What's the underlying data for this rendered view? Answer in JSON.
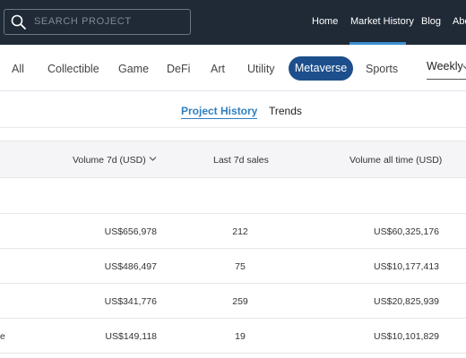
{
  "topnav": {
    "search_placeholder": "SEARCH PROJECT",
    "links": [
      "Home",
      "Market History",
      "Blog",
      "Abo"
    ]
  },
  "categories": {
    "items": [
      "All",
      "Collectible",
      "Game",
      "DeFi",
      "Art",
      "Utility",
      "Metaverse",
      "Sports"
    ],
    "active": "Metaverse",
    "period": "Weekly"
  },
  "subtabs": {
    "project_history": "Project History",
    "trends": "Trends"
  },
  "table": {
    "headers": {
      "volume_7d": "Volume 7d (USD)",
      "last_7d_sales": "Last 7d sales",
      "volume_all_time": "Volume all time (USD)"
    },
    "rows": [
      {
        "name": "",
        "volume_7d": "US$656,978",
        "sales": "212",
        "volume_all": "US$60,325,176"
      },
      {
        "name": "",
        "volume_7d": "US$486,497",
        "sales": "75",
        "volume_all": "US$10,177,413"
      },
      {
        "name": "",
        "volume_7d": "US$341,776",
        "sales": "259",
        "volume_all": "US$20,825,939"
      },
      {
        "name": "e",
        "volume_7d": "US$149,118",
        "sales": "19",
        "volume_all": "US$10,101,829"
      }
    ]
  },
  "colors": {
    "nav_bg": "#1f2a36",
    "accent": "#1d4f8c",
    "link_blue": "#2f7fc0"
  }
}
